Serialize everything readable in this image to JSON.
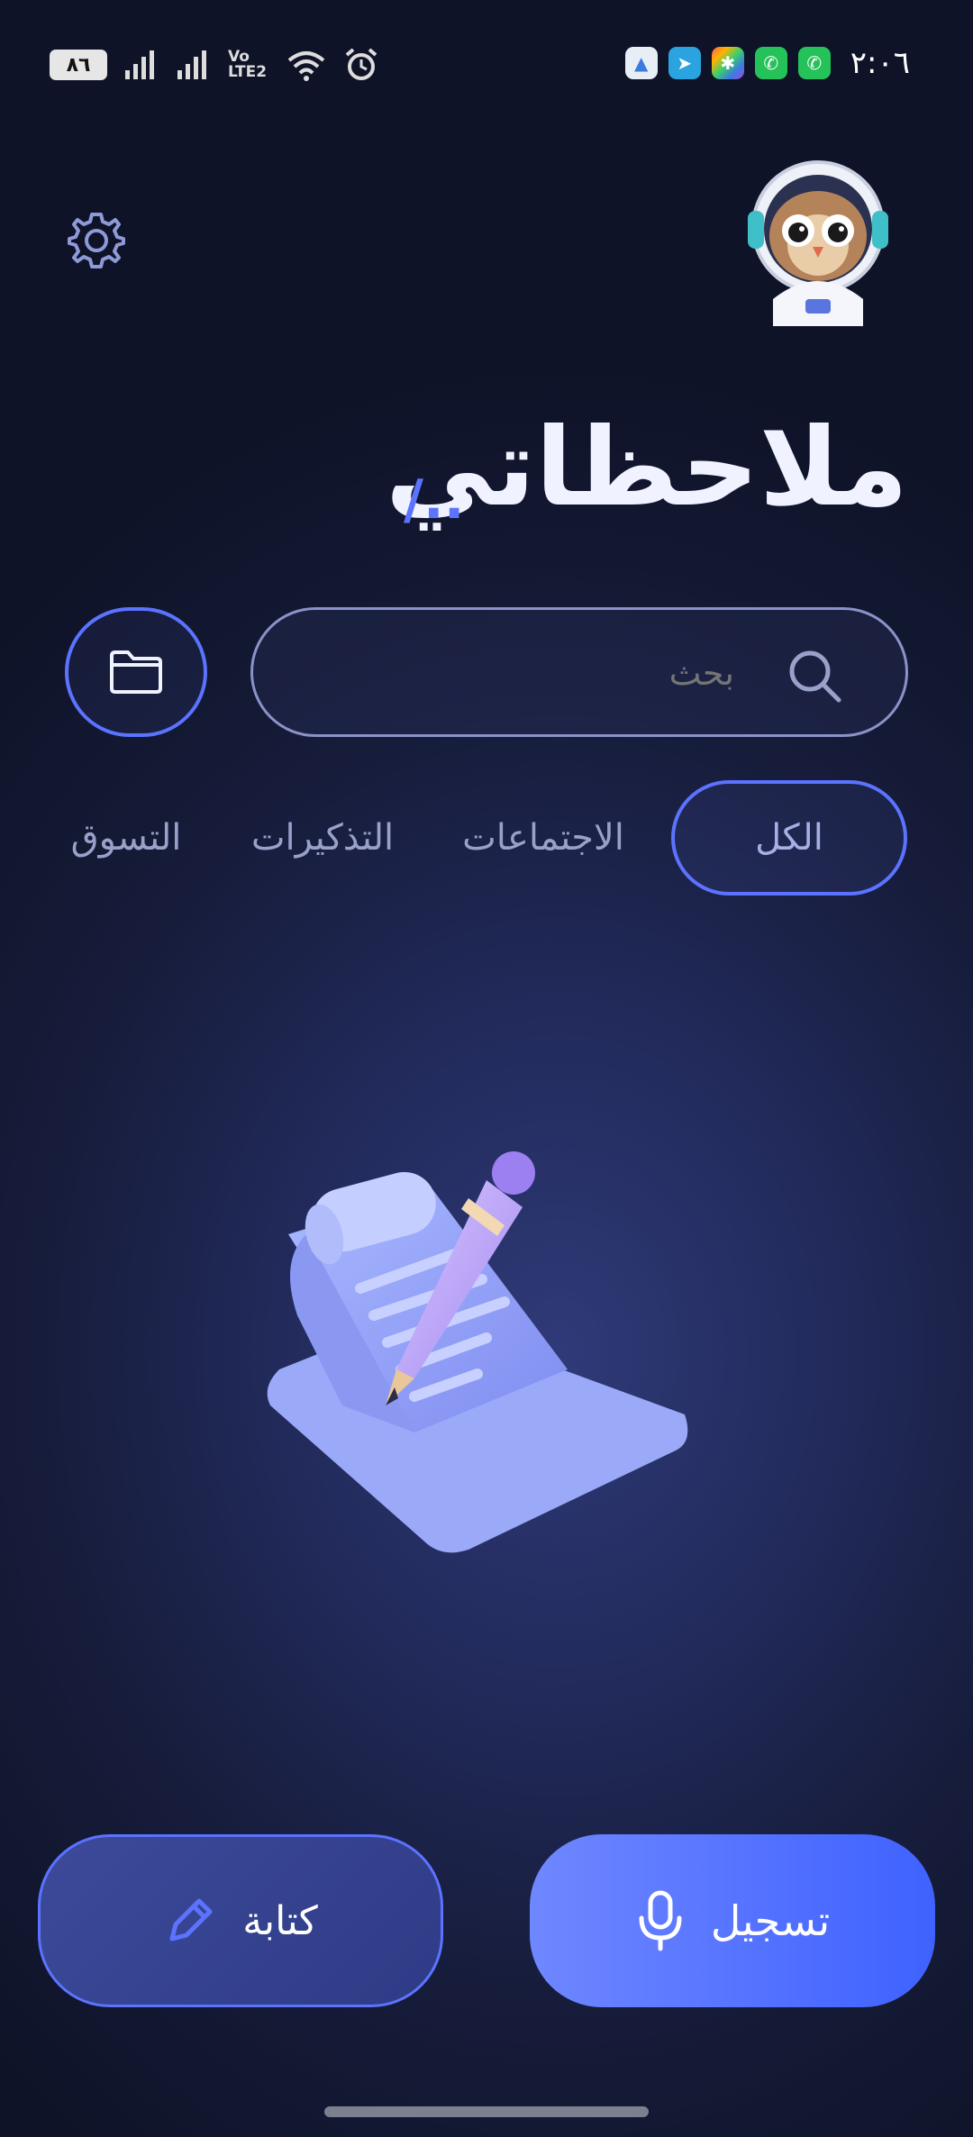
{
  "status_bar": {
    "battery": "٨٦",
    "network_label": "Vo LTE2",
    "time": "٢:٠٦",
    "notification_icons": [
      "testflight-icon",
      "telegram-icon",
      "multicolor-app-icon",
      "whatsapp-icon",
      "whatsapp-business-icon"
    ],
    "status_icons": [
      "signal-icon",
      "signal-icon",
      "wifi-icon",
      "alarm-icon"
    ]
  },
  "header": {
    "settings_icon": "gear-icon",
    "avatar": "owl-astronaut-mascot",
    "title": "ملاحظاتي",
    "title_suffix": "/.."
  },
  "search": {
    "placeholder": "بحث",
    "icon": "search-icon",
    "folder_icon": "folder-icon"
  },
  "tabs": [
    {
      "label": "الكل",
      "active": true
    },
    {
      "label": "الاجتماعات",
      "active": false
    },
    {
      "label": "التذكيرات",
      "active": false
    },
    {
      "label": "التسوق",
      "active": false
    }
  ],
  "empty_state": {
    "illustration": "note-paper-with-pencil"
  },
  "actions": {
    "write_label": "كتابة",
    "write_icon": "pencil-icon",
    "record_label": "تسجيل",
    "record_icon": "microphone-icon"
  },
  "colors": {
    "accent": "#5b73ff",
    "record_button_start": "#6f87ff",
    "record_button_end": "#3f62ff",
    "background": "#161c3a"
  }
}
